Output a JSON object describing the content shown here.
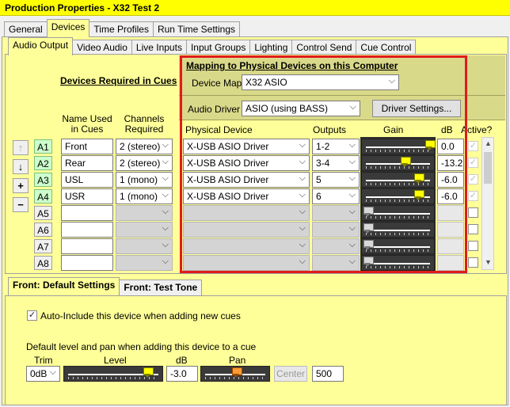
{
  "window": {
    "title": "Production Properties - X32 Test 2"
  },
  "top_tabs": [
    "General",
    "Devices",
    "Time Profiles",
    "Run Time Settings"
  ],
  "sub_tabs": [
    "Audio Output",
    "Video Audio",
    "Live Inputs",
    "Input Groups",
    "Lighting",
    "Control Send",
    "Cue Control"
  ],
  "left": {
    "heading": "Devices Required in Cues",
    "col_name": "Name Used",
    "col_name2": "in Cues",
    "col_channels": "Channels",
    "col_channels2": "Required",
    "buttons": {
      "up": "↑",
      "down": "↓",
      "add": "+",
      "remove": "−"
    }
  },
  "mapping": {
    "heading": "Mapping to Physical Devices on this Computer",
    "device_map_label": "Device Map",
    "device_map_value": "X32 ASIO",
    "audio_driver_label": "Audio Driver",
    "audio_driver_value": "ASIO (using BASS)",
    "driver_settings_button": "Driver Settings...",
    "col_physical": "Physical Device",
    "col_outputs": "Outputs",
    "col_gain": "Gain",
    "col_db": "dB",
    "col_active": "Active?"
  },
  "rows": [
    {
      "cue": "A1",
      "name": "Front",
      "channels": "2 (stereo)",
      "device": "X-USB ASIO Driver",
      "outputs": "1-2",
      "gain": 1.0,
      "db": "0.0",
      "active": true
    },
    {
      "cue": "A2",
      "name": "Rear",
      "channels": "2 (stereo)",
      "device": "X-USB ASIO Driver",
      "outputs": "3-4",
      "gain": 0.6,
      "db": "-13.2",
      "active": true
    },
    {
      "cue": "A3",
      "name": "USL",
      "channels": "1 (mono)",
      "device": "X-USB ASIO Driver",
      "outputs": "5",
      "gain": 0.82,
      "db": "-6.0",
      "active": true
    },
    {
      "cue": "A4",
      "name": "USR",
      "channels": "1 (mono)",
      "device": "X-USB ASIO Driver",
      "outputs": "6",
      "gain": 0.82,
      "db": "-6.0",
      "active": true
    },
    {
      "cue": "A5",
      "name": "",
      "channels": "",
      "device": "",
      "outputs": "",
      "gain": 0.0,
      "db": "",
      "active": false
    },
    {
      "cue": "A6",
      "name": "",
      "channels": "",
      "device": "",
      "outputs": "",
      "gain": 0.0,
      "db": "",
      "active": false
    },
    {
      "cue": "A7",
      "name": "",
      "channels": "",
      "device": "",
      "outputs": "",
      "gain": 0.0,
      "db": "",
      "active": false
    },
    {
      "cue": "A8",
      "name": "",
      "channels": "",
      "device": "",
      "outputs": "",
      "gain": 0.0,
      "db": "",
      "active": false
    }
  ],
  "bottom_tabs": [
    "Front: Default Settings",
    "Front: Test Tone"
  ],
  "bottom": {
    "auto_include_label": "Auto-Include this device when adding new cues",
    "auto_include_checked": true,
    "default_label": "Default level and pan when adding this device to a cue",
    "trim_label": "Trim",
    "trim_value": "0dB",
    "level_label": "Level",
    "level_fraction": 0.88,
    "db_label": "dB",
    "db_value": "-3.0",
    "pan_label": "Pan",
    "pan_value": 0.5,
    "center_button": "Center",
    "pan_number": "500"
  },
  "colors": {
    "panel": "#ffff99",
    "titlebar": "#ffff00",
    "highlight_border": "#e01b1b",
    "mapping_bg": "#d9d98a"
  }
}
